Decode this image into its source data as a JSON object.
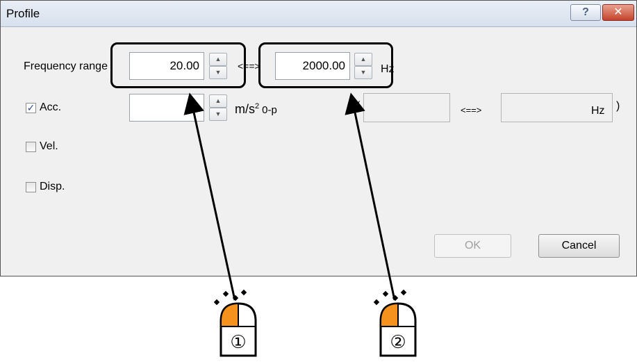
{
  "window": {
    "title": "Profile",
    "help_label": "?",
    "close_label": "✕"
  },
  "frequency_range": {
    "label": "Frequency range",
    "low_value": "20.00",
    "separator": "<==>",
    "high_value": "2000.00",
    "unit": "Hz"
  },
  "acc": {
    "label": "Acc.",
    "checked": true,
    "value": "",
    "unit": "m/s",
    "unit_sup": "2",
    "unit_sub": "0-p",
    "range_open": "(",
    "range_separator": "<==>",
    "range_unit": "Hz",
    "range_close": ")"
  },
  "vel": {
    "label": "Vel.",
    "checked": false
  },
  "disp": {
    "label": "Disp.",
    "checked": false
  },
  "buttons": {
    "ok_label": "OK",
    "cancel_label": "Cancel"
  },
  "annotations": {
    "mouse_1_label": "①",
    "mouse_2_label": "②"
  },
  "colors": {
    "callout": "#000000",
    "mouse_left_button": "#f5921e",
    "close_button": "#c5432b"
  },
  "icons": [
    "spin-up-icon",
    "spin-down-icon",
    "checkmark-icon",
    "mouse-icon",
    "sparkle-icon",
    "arrow-icon"
  ]
}
